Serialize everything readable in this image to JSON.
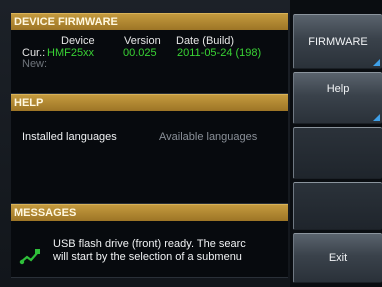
{
  "firmware": {
    "title": "DEVICE FIRMWARE",
    "columns": {
      "device": "Device",
      "version": "Version",
      "date": "Date (Build)"
    },
    "current": {
      "label": "Cur.:",
      "device": "HMF25xx",
      "version": "00.025",
      "date": "2011-05-24 (198)"
    },
    "new": {
      "label": "New:"
    }
  },
  "help": {
    "title": "HELP",
    "installed_languages": "Installed languages",
    "available_languages": "Available languages"
  },
  "messages": {
    "title": "MESSAGES",
    "line1": "USB flash drive (front) ready. The searc",
    "line2": "will start by the selection of a submenu",
    "icon": "usb-plug-icon",
    "icon_color": "#2fbf3a"
  },
  "softkeys": {
    "firmware": "FIRMWARE",
    "help": "Help",
    "exit": "Exit"
  },
  "colors": {
    "header": "#b08a33",
    "value_green": "#39d234",
    "arrow_blue": "#3fa0e8"
  }
}
